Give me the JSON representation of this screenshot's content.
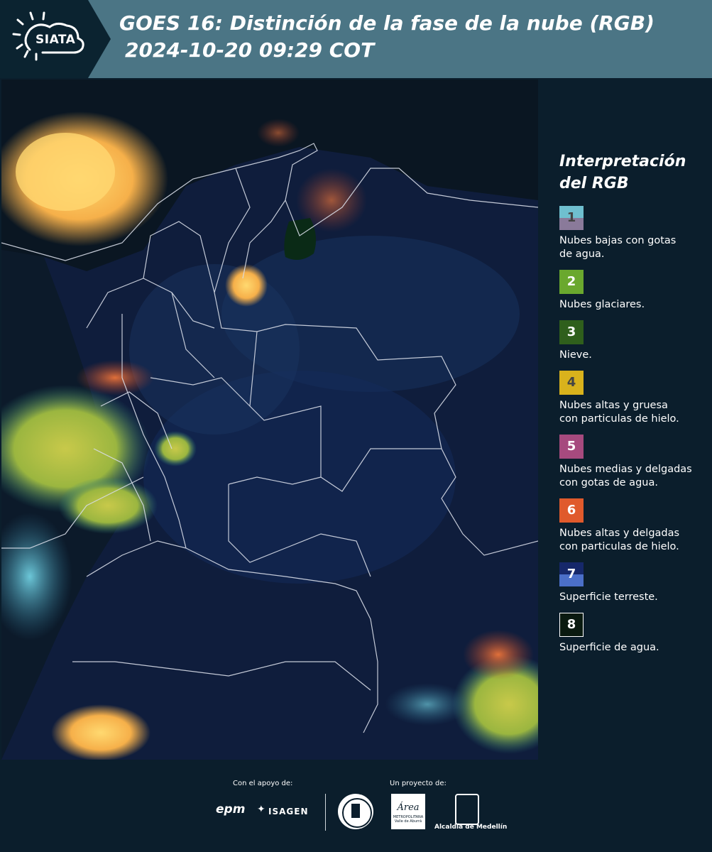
{
  "header": {
    "logo_text": "SIATA",
    "title_line1": "GOES 16: Distinción de la fase de la nube (RGB)",
    "title_line2": "2024-10-20 09:29 COT"
  },
  "legend": {
    "title_line1": "Interpretación",
    "title_line2": "del RGB",
    "items": [
      {
        "number": "1",
        "label_lines": [
          "Nubes bajas con gotas",
          "de agua."
        ],
        "colors": [
          "#6fbfcf",
          "#8a7a9a"
        ],
        "text_color": "#444444"
      },
      {
        "number": "2",
        "label_lines": [
          "Nubes glaciares."
        ],
        "colors": [
          "#6aa82e"
        ],
        "text_color": "#ffffff"
      },
      {
        "number": "3",
        "label_lines": [
          "Nieve."
        ],
        "colors": [
          "#2f5f1c"
        ],
        "text_color": "#ffffff"
      },
      {
        "number": "4",
        "label_lines": [
          "Nubes altas y gruesa",
          "con particulas de hielo."
        ],
        "colors": [
          "#d9b21c"
        ],
        "text_color": "#444444"
      },
      {
        "number": "5",
        "label_lines": [
          "Nubes medias y delgadas",
          "con gotas de agua."
        ],
        "colors": [
          "#a64a7e"
        ],
        "text_color": "#ffffff"
      },
      {
        "number": "6",
        "label_lines": [
          "Nubes altas y delgadas",
          "con particulas de hielo."
        ],
        "colors": [
          "#e05a2c"
        ],
        "text_color": "#ffffff"
      },
      {
        "number": "7",
        "label_lines": [
          "Superficie terreste."
        ],
        "colors": [
          "#16286a",
          "#4b6fc8"
        ],
        "text_color": "#ffffff"
      },
      {
        "number": "8",
        "label_lines": [
          "Superficie de agua."
        ],
        "colors": [
          "#0a1a10"
        ],
        "text_color": "#ffffff"
      }
    ]
  },
  "footer": {
    "support_label": "Con el apoyo de:",
    "project_label": "Un proyecto de:",
    "sponsor_epm": "epm",
    "sponsor_isagen": "ISAGEN",
    "area_logo": "Área",
    "area_sub": "METROPOLITANA",
    "area_sub2": "Valle de Aburrá",
    "alcaldia": "Alcaldía de Medellín"
  }
}
